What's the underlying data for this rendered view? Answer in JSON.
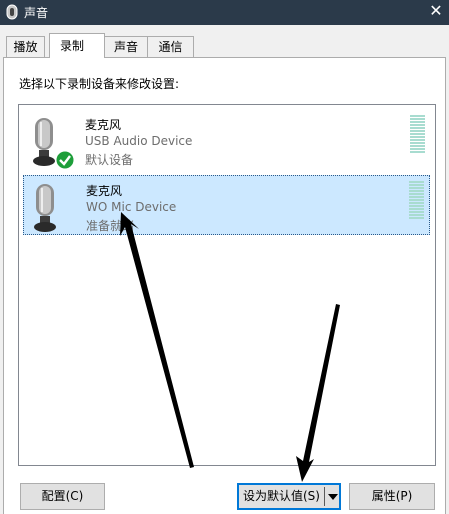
{
  "window": {
    "title": "声音",
    "close_glyph": "✕"
  },
  "tabs": [
    {
      "label": "播放"
    },
    {
      "label": "录制",
      "active": true
    },
    {
      "label": "声音"
    },
    {
      "label": "通信"
    }
  ],
  "instruction": "选择以下录制设备来修改设置:",
  "devices": [
    {
      "name": "麦克风",
      "description": "USB Audio Device",
      "status": "默认设备",
      "icon": "microphone-icon",
      "badge": "default-check-icon",
      "selected": false,
      "meter_level": 0
    },
    {
      "name": "麦克风",
      "description": "WO Mic Device",
      "status": "准备就绪",
      "icon": "microphone-icon",
      "selected": true,
      "meter_level": 0
    }
  ],
  "buttons": {
    "configure": "配置(C)",
    "set_default": "设为默认值(S)",
    "properties": "属性(P)"
  },
  "colors": {
    "titlebar": "#2b3a4a",
    "selection": "#cce8ff",
    "check_badge": "#1e9e3a",
    "meter_empty": "#a8dcd0",
    "annotation_arrow": "#000000"
  }
}
